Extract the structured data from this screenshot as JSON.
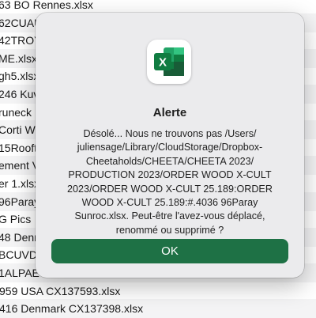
{
  "background_files": [
    "63 BO Rennes.xlsx",
    "62CUAU",
    "42TROY",
    "ME.xlsx",
    "gh5.xlsx",
    "246 Kuv",
    "runeck",
    "Corti We",
    "15Rooft",
    "ement V",
    "er 1.xlsx",
    "96Paray",
    "G Pics",
    "48 Denm",
    "BCUVDA",
    "1ALPAE",
    "959 USA CX137593.xlsx",
    "416 Denmark CX137398.xlsx"
  ],
  "dialog": {
    "icon": "microsoft-excel-icon",
    "icon_letter": "X",
    "title": "Alerte",
    "message": "Désolé... Nous ne trouvons pas /Users/\njuliensage/Library/CloudStorage/Dropbox-\nCheetaholds/CHEETA/CHEETA 2023/\nPRODUCTION 2023/ORDER WOOD X-CULT\n2023/ORDER WOOD X-CULT 25.189:ORDER\nWOOD X-CULT 25.189:#.4036 96Paray\nSunroc.xlsx. Peut-être l'avez-vous déplacé,\nrenommé ou supprimé ?",
    "ok_label": "OK"
  },
  "colors": {
    "excel_green": "#1e7145",
    "dialog_bg": "#ebebed"
  }
}
